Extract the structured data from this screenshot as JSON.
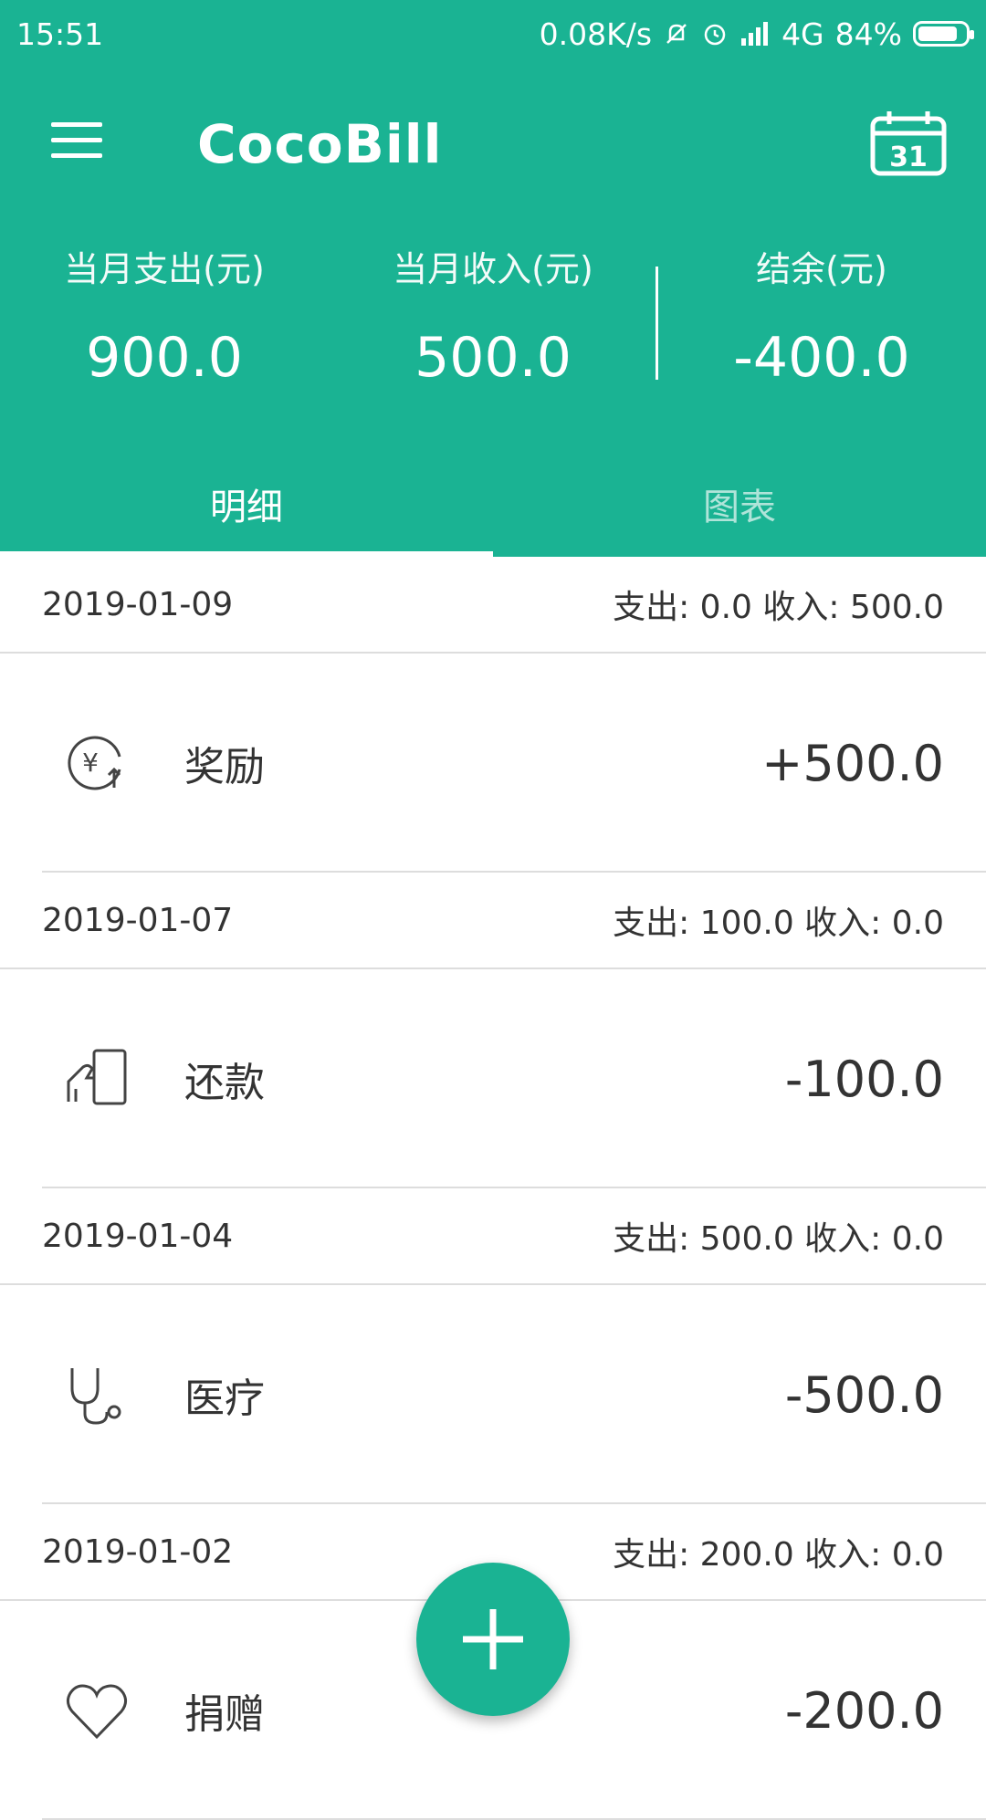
{
  "status_bar": {
    "time": "15:51",
    "net_speed": "0.08K/s",
    "network": "4G",
    "battery": "84%",
    "battery_level": 0.84
  },
  "app": {
    "title": "CocoBill",
    "accent_color": "#1ab393"
  },
  "summary": {
    "expense_label": "当月支出(元)",
    "expense_value": "900.0",
    "income_label": "当月收入(元)",
    "income_value": "500.0",
    "balance_label": "结余(元)",
    "balance_value": "-400.0"
  },
  "tabs": [
    {
      "label": "明细",
      "active": true
    },
    {
      "label": "图表",
      "active": false
    }
  ],
  "days": [
    {
      "date": "2019-01-09",
      "summary": "支出: 0.0 收入: 500.0",
      "items": [
        {
          "icon": "income-yuan-icon",
          "name": "奖励",
          "amount": "+500.0"
        }
      ]
    },
    {
      "date": "2019-01-07",
      "summary": "支出: 100.0 收入: 0.0",
      "items": [
        {
          "icon": "repayment-card-icon",
          "name": "还款",
          "amount": "-100.0"
        }
      ]
    },
    {
      "date": "2019-01-04",
      "summary": "支出: 500.0 收入: 0.0",
      "items": [
        {
          "icon": "stethoscope-icon",
          "name": "医疗",
          "amount": "-500.0"
        }
      ]
    },
    {
      "date": "2019-01-02",
      "summary": "支出: 200.0 收入: 0.0",
      "items": [
        {
          "icon": "heart-icon",
          "name": "捐赠",
          "amount": "-200.0"
        }
      ]
    }
  ],
  "calendar_day": "31",
  "fab_icon": "plus-icon"
}
